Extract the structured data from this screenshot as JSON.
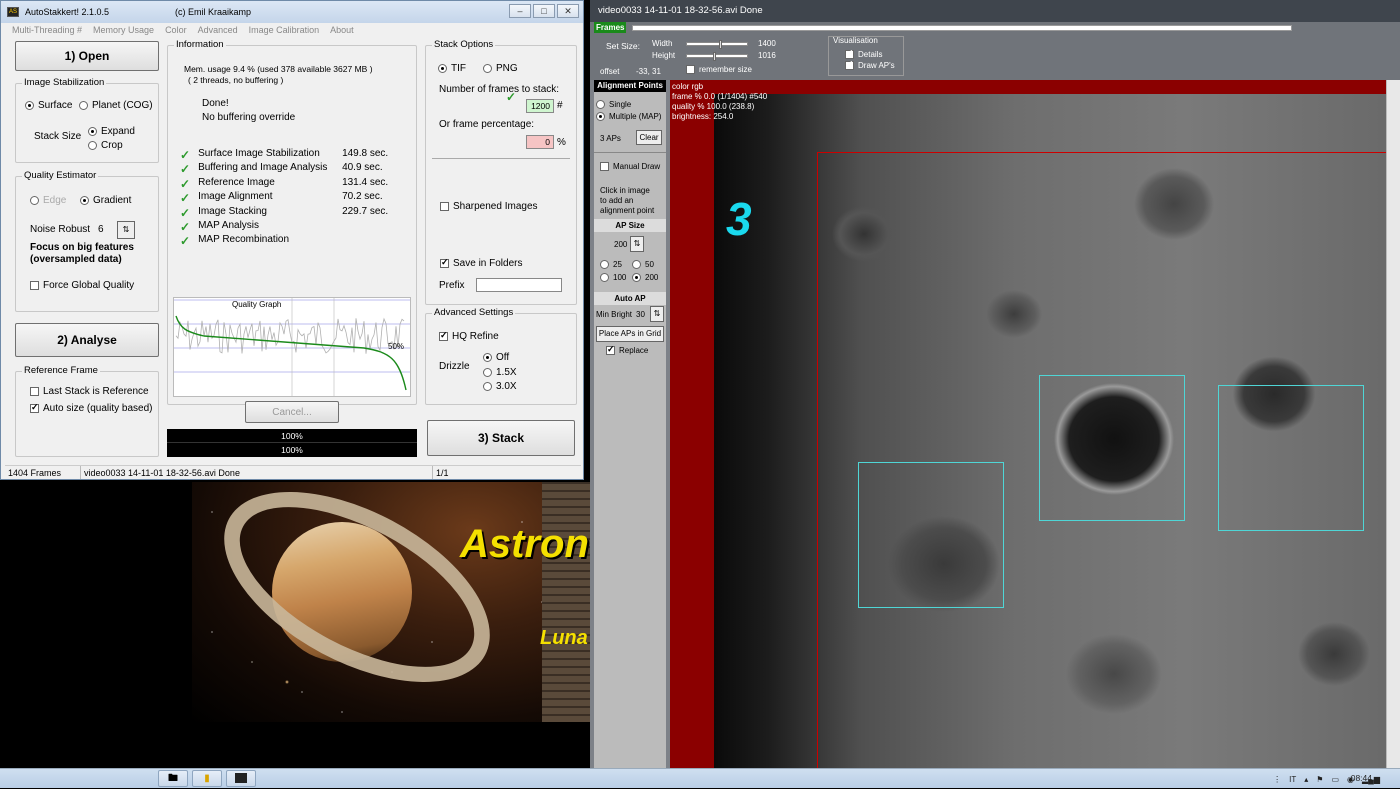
{
  "wallpaper": {
    "title": "Astron",
    "subtitle": "Luna"
  },
  "main": {
    "app_title": "AutoStakkert! 2.1.0.5",
    "author": "(c) Emil Kraaikamp",
    "window_buttons": [
      "–",
      "□",
      "✕"
    ],
    "menu": [
      "Multi-Threading #",
      "Memory Usage",
      "Color",
      "Advanced",
      "Image Calibration",
      "About"
    ],
    "open_btn": "1) Open",
    "analyse_btn": "2) Analyse",
    "stack_btn": "3) Stack",
    "stabilization": {
      "title": "Image Stabilization",
      "surface": "Surface",
      "planet": "Planet (COG)",
      "stack_size": "Stack Size",
      "expand": "Expand",
      "crop": "Crop"
    },
    "quality": {
      "title": "Quality Estimator",
      "edge": "Edge",
      "gradient": "Gradient",
      "noise_label": "Noise Robust",
      "noise_value": "6",
      "focus_line1": "Focus on big features",
      "focus_line2": "(oversampled data)",
      "force_global": "Force Global Quality"
    },
    "reference": {
      "title": "Reference Frame",
      "last_stack": "Last Stack is Reference",
      "auto_size": "Auto size (quality based)"
    },
    "info": {
      "title": "Information",
      "mem_line1": "Mem. usage 9.4 %  (used 378 available 3627 MB )",
      "mem_line2": "( 2 threads, no buffering )",
      "done": "Done!",
      "no_buffer": "No buffering override",
      "steps": [
        {
          "name": "Surface Image Stabilization",
          "time": "149.8 sec."
        },
        {
          "name": "Buffering and Image Analysis",
          "time": "40.9 sec."
        },
        {
          "name": "Reference Image",
          "time": "131.4 sec."
        },
        {
          "name": "Image Alignment",
          "time": "70.2 sec."
        },
        {
          "name": "Image Stacking",
          "time": "229.7 sec."
        },
        {
          "name": "MAP Analysis",
          "time": ""
        },
        {
          "name": "MAP Recombination",
          "time": ""
        }
      ]
    },
    "graph": {
      "title": "Quality Graph",
      "pct": "50%"
    },
    "cancel_btn": "Cancel...",
    "progress": [
      "100%",
      "100%"
    ],
    "stack_options": {
      "title": "Stack Options",
      "tif": "TIF",
      "png": "PNG",
      "frames_label": "Number of frames to stack:",
      "frames_value": "1200",
      "frames_unit": "#",
      "pct_label": "Or frame percentage:",
      "pct_value": "0",
      "pct_unit": "%",
      "sharpened": "Sharpened Images",
      "save_folders": "Save in Folders",
      "prefix": "Prefix"
    },
    "advanced": {
      "title": "Advanced Settings",
      "hq": "HQ Refine",
      "drizzle": "Drizzle",
      "off": "Off",
      "d15": "1.5X",
      "d30": "3.0X"
    },
    "status": {
      "frames": "1404 Frames",
      "file": "video0033 14-11-01 18-32-56.avi   Done",
      "page": "1/1"
    }
  },
  "video": {
    "title": "video0033 14-11-01 18-32-56.avi   Done",
    "frames_label": "Frames",
    "set_size": "Set Size:",
    "width_label": "Width",
    "width_value": "1400",
    "height_label": "Height",
    "height_value": "1016",
    "offset_label": "offset",
    "offset_value": "-33, 31",
    "remember": "remember size",
    "visualisation": {
      "title": "Visualisation",
      "details": "Details",
      "draw_aps": "Draw AP's"
    },
    "overlay": [
      "color rgb",
      "frame % 0.0  (1/1404) #540",
      "quality % 100.0  (238.8)",
      "brightness: 254.0"
    ],
    "big_number": "3",
    "ap_panel": {
      "header": "Alignment Points",
      "single": "Single",
      "multiple": "Multiple (MAP)",
      "ap_count": "3 APs",
      "clear": "Clear",
      "manual": "Manual Draw",
      "hint": [
        "Click in image",
        "to add an",
        "alignment point"
      ],
      "ap_size_head": "AP Size",
      "ap_size": "200",
      "s25": "25",
      "s50": "50",
      "s100": "100",
      "s200": "200",
      "auto_head": "Auto AP",
      "min_bright": "Min Bright",
      "min_bright_val": "30",
      "place_grid": "Place APs in Grid",
      "replace": "Replace"
    }
  },
  "taskbar": {
    "lang": "IT",
    "clock": "08:44"
  },
  "colors": {
    "ap_box": "#4fd6d6",
    "roi": "#cc0000",
    "frame_bg": "#8b0000",
    "check_green": "#2d9a2d",
    "big_number": "#1ad9ee"
  }
}
